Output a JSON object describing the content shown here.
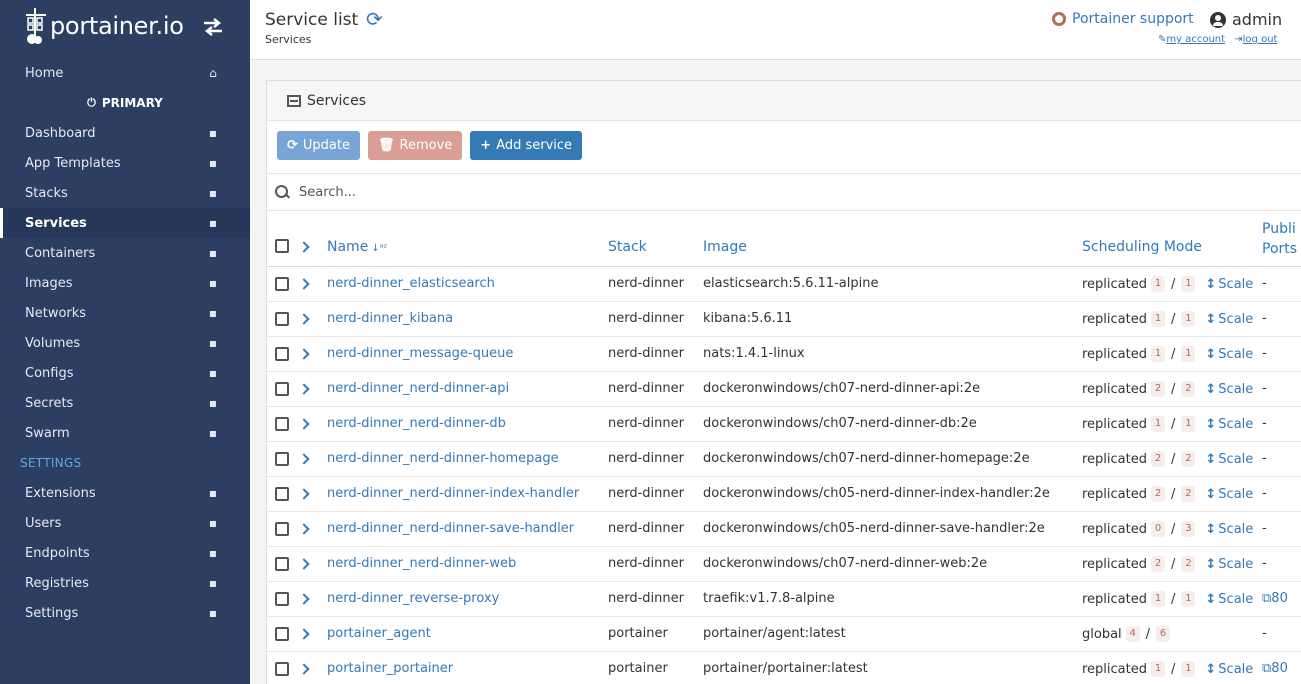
{
  "brand": {
    "name": "portainer.io"
  },
  "sidebar": {
    "home": "Home",
    "endpoint": "PRIMARY",
    "items": [
      {
        "label": "Dashboard",
        "icon": "tachometer-icon"
      },
      {
        "label": "App Templates",
        "icon": "rocket-icon"
      },
      {
        "label": "Stacks",
        "icon": "list-icon"
      },
      {
        "label": "Services",
        "icon": "list-alt-icon",
        "active": true
      },
      {
        "label": "Containers",
        "icon": "server-icon"
      },
      {
        "label": "Images",
        "icon": "clone-icon"
      },
      {
        "label": "Networks",
        "icon": "sitemap-icon"
      },
      {
        "label": "Volumes",
        "icon": "cubes-icon"
      },
      {
        "label": "Configs",
        "icon": "file-code-icon"
      },
      {
        "label": "Secrets",
        "icon": "user-secret-icon"
      },
      {
        "label": "Swarm",
        "icon": "object-group-icon"
      }
    ],
    "settings_title": "SETTINGS",
    "settings_items": [
      {
        "label": "Extensions",
        "icon": "bolt-icon"
      },
      {
        "label": "Users",
        "icon": "users-icon"
      },
      {
        "label": "Endpoints",
        "icon": "plug-icon"
      },
      {
        "label": "Registries",
        "icon": "database-icon"
      },
      {
        "label": "Settings",
        "icon": "cogs-icon"
      }
    ]
  },
  "header": {
    "title": "Service list",
    "breadcrumb": "Services",
    "support": "Portainer support",
    "user": "admin",
    "my_account": "my account",
    "log_out": "log out"
  },
  "panel": {
    "title": "Services",
    "update": "Update",
    "remove": "Remove",
    "add": "Add service",
    "search_placeholder": "Search..."
  },
  "table": {
    "columns": {
      "name": "Name",
      "stack": "Stack",
      "image": "Image",
      "sched": "Scheduling Mode",
      "ports": "Publi Ports"
    },
    "scale_label": "Scale",
    "rows": [
      {
        "name": "nerd-dinner_elasticsearch",
        "stack": "nerd-dinner",
        "image": "elasticsearch:5.6.11-alpine",
        "mode": "replicated",
        "running": "1",
        "total": "1",
        "scale": true,
        "ports": "-"
      },
      {
        "name": "nerd-dinner_kibana",
        "stack": "nerd-dinner",
        "image": "kibana:5.6.11",
        "mode": "replicated",
        "running": "1",
        "total": "1",
        "scale": true,
        "ports": "-"
      },
      {
        "name": "nerd-dinner_message-queue",
        "stack": "nerd-dinner",
        "image": "nats:1.4.1-linux",
        "mode": "replicated",
        "running": "1",
        "total": "1",
        "scale": true,
        "ports": "-"
      },
      {
        "name": "nerd-dinner_nerd-dinner-api",
        "stack": "nerd-dinner",
        "image": "dockeronwindows/ch07-nerd-dinner-api:2e",
        "mode": "replicated",
        "running": "2",
        "total": "2",
        "scale": true,
        "ports": "-"
      },
      {
        "name": "nerd-dinner_nerd-dinner-db",
        "stack": "nerd-dinner",
        "image": "dockeronwindows/ch07-nerd-dinner-db:2e",
        "mode": "replicated",
        "running": "1",
        "total": "1",
        "scale": true,
        "ports": "-"
      },
      {
        "name": "nerd-dinner_nerd-dinner-homepage",
        "stack": "nerd-dinner",
        "image": "dockeronwindows/ch07-nerd-dinner-homepage:2e",
        "mode": "replicated",
        "running": "2",
        "total": "2",
        "scale": true,
        "ports": "-"
      },
      {
        "name": "nerd-dinner_nerd-dinner-index-handler",
        "stack": "nerd-dinner",
        "image": "dockeronwindows/ch05-nerd-dinner-index-handler:2e",
        "mode": "replicated",
        "running": "2",
        "total": "2",
        "scale": true,
        "ports": "-"
      },
      {
        "name": "nerd-dinner_nerd-dinner-save-handler",
        "stack": "nerd-dinner",
        "image": "dockeronwindows/ch05-nerd-dinner-save-handler:2e",
        "mode": "replicated",
        "running": "0",
        "total": "3",
        "scale": true,
        "ports": "-"
      },
      {
        "name": "nerd-dinner_nerd-dinner-web",
        "stack": "nerd-dinner",
        "image": "dockeronwindows/ch07-nerd-dinner-web:2e",
        "mode": "replicated",
        "running": "2",
        "total": "2",
        "scale": true,
        "ports": "-"
      },
      {
        "name": "nerd-dinner_reverse-proxy",
        "stack": "nerd-dinner",
        "image": "traefik:v1.7.8-alpine",
        "mode": "replicated",
        "running": "1",
        "total": "1",
        "scale": true,
        "ports": "80",
        "port_link": true
      },
      {
        "name": "portainer_agent",
        "stack": "portainer",
        "image": "portainer/agent:latest",
        "mode": "global",
        "running": "4",
        "total": "6",
        "scale": false,
        "ports": "-"
      },
      {
        "name": "portainer_portainer",
        "stack": "portainer",
        "image": "portainer/portainer:latest",
        "mode": "replicated",
        "running": "1",
        "total": "1",
        "scale": true,
        "ports": "80",
        "port_link": true
      }
    ]
  },
  "colors": {
    "sidebar": "#2d3e63",
    "accent": "#337ab7",
    "badge": "#b36a5f"
  }
}
